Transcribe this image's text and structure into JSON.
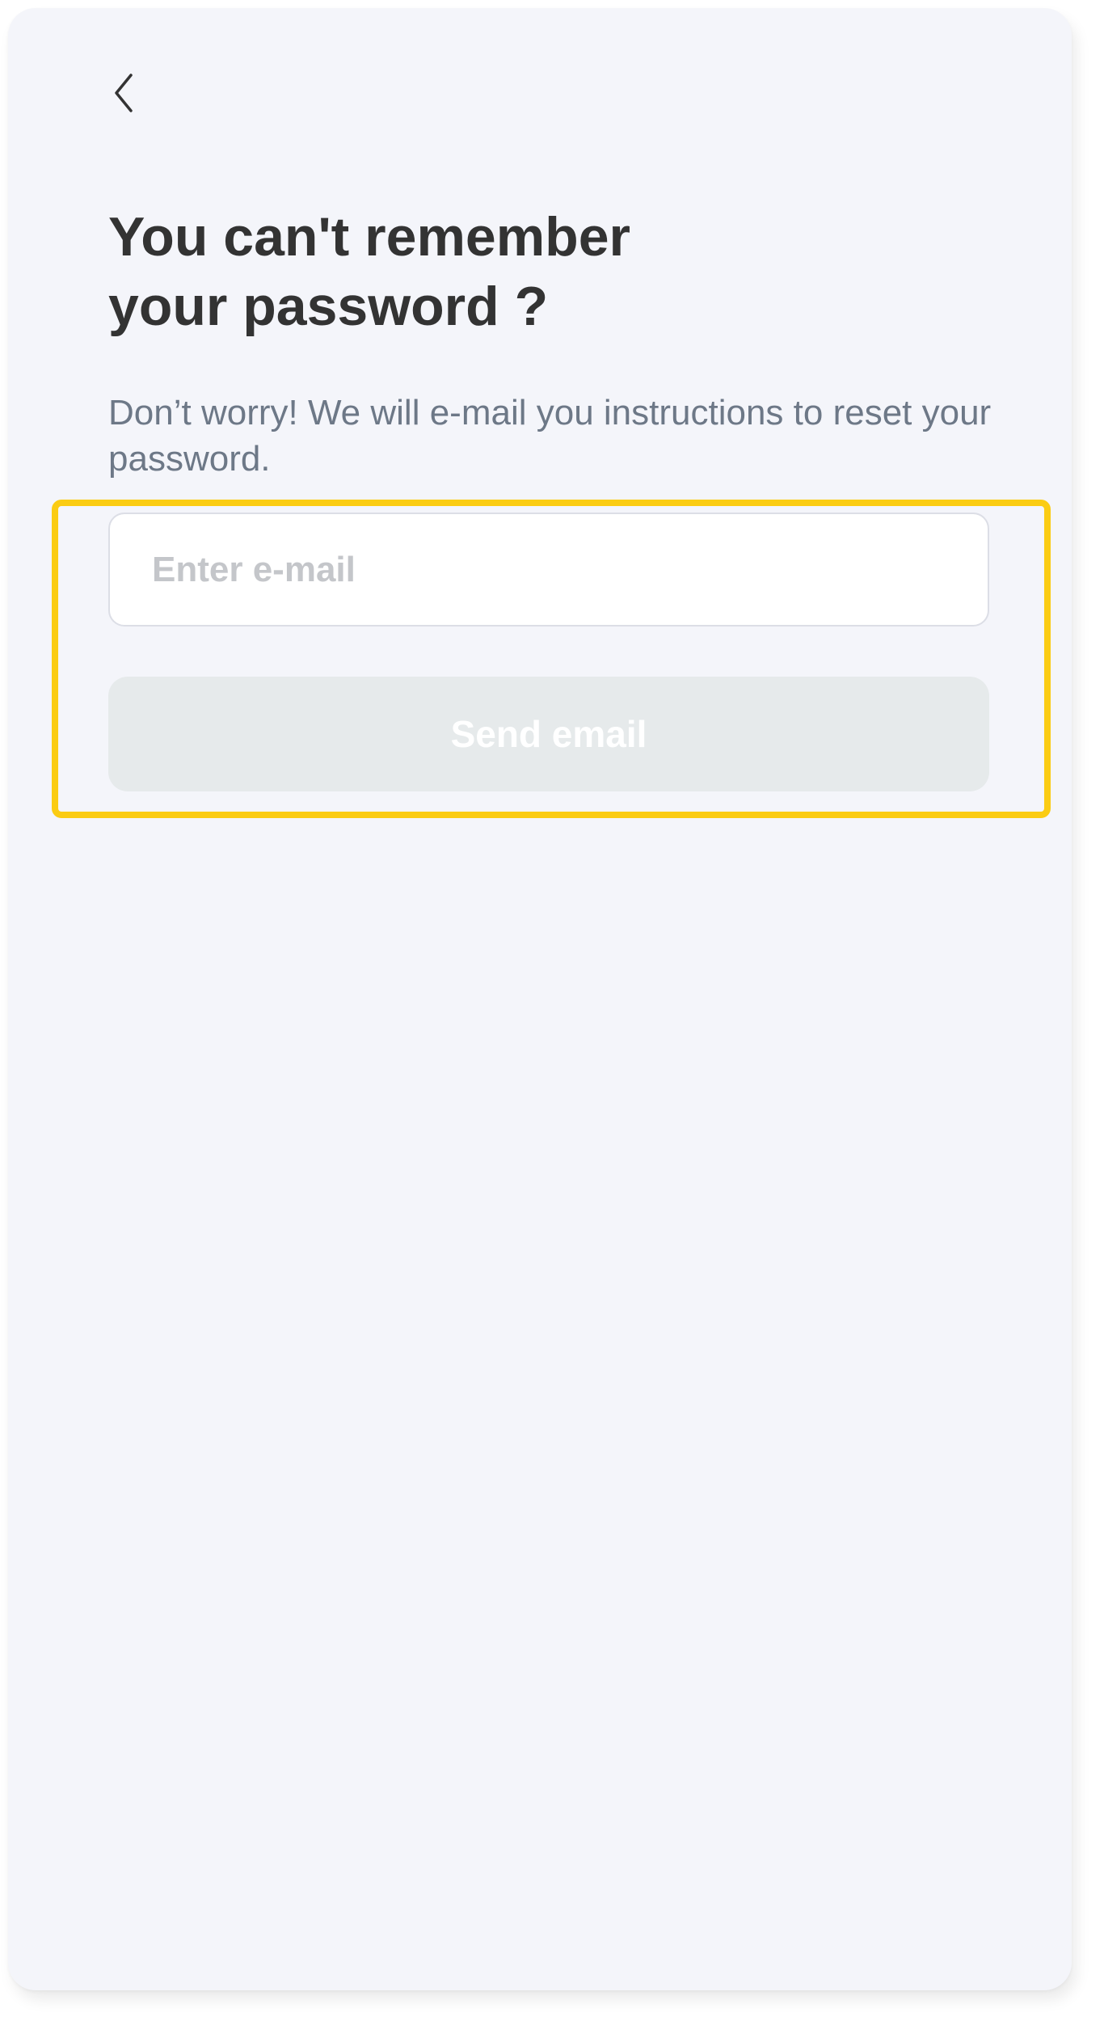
{
  "header": {
    "back_icon": "chevron-left-icon"
  },
  "main": {
    "title_lines": [
      "You can't remember",
      "your password ?"
    ],
    "subtitle": "Don’t worry! We will e-mail you instructions to reset your password.",
    "email_field": {
      "placeholder": "Enter e-mail",
      "value": ""
    },
    "send_button_label": "Send email"
  },
  "colors": {
    "background": "#f4f5fa",
    "title": "#333333",
    "subtitle": "#6d7887",
    "highlight": "#fbcc13",
    "button_disabled": "#e6eaeb",
    "placeholder": "#c4c6ca"
  }
}
